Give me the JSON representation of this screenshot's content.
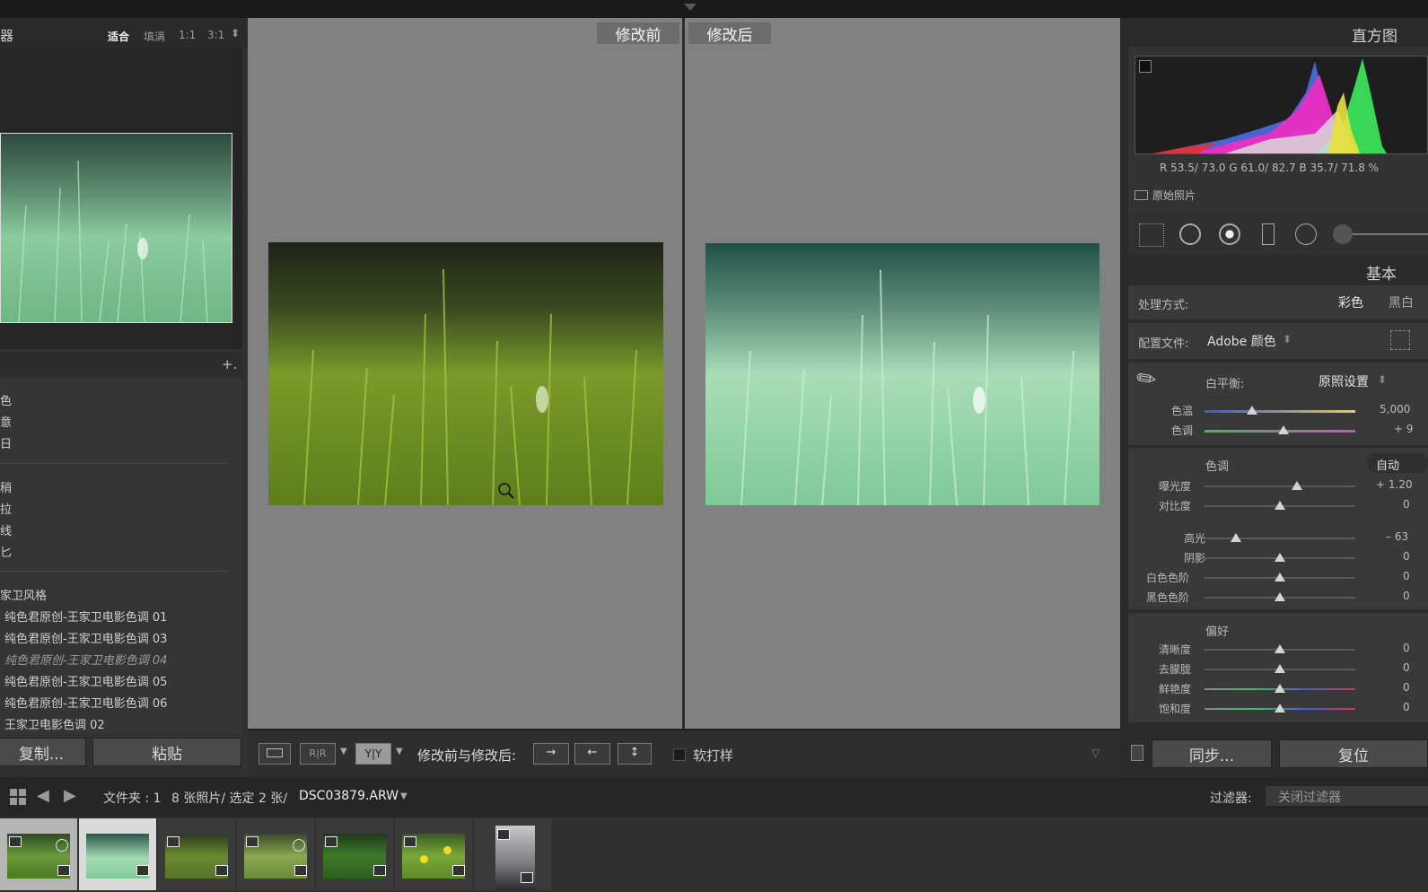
{
  "left_panel": {
    "nav_title": "器",
    "zoom_options": [
      "适合",
      "填满",
      "1:1",
      "3:1"
    ],
    "add_preset": "+.",
    "preset_groups": [
      [
        "色",
        "意",
        "日"
      ],
      [
        "稍",
        "拉",
        "线",
        "匕"
      ]
    ],
    "preset_folder": "家卫风格",
    "presets": [
      "纯色君原创-王家卫电影色调 01",
      "纯色君原创-王家卫电影色调 03",
      "纯色君原创-王家卫电影色调 04",
      "纯色君原创-王家卫电影色调 05",
      "纯色君原创-王家卫电影色调 06",
      "王家卫电影色调 02"
    ],
    "copy_button": "复制...",
    "paste_button": "粘贴"
  },
  "center": {
    "before_label": "修改前",
    "after_label": "修改后",
    "toolbar": {
      "view_label": "修改前与修改后:",
      "soft_proof": "软打样",
      "ra_text": "R|R",
      "yy_text": "Y|Y"
    }
  },
  "right_panel": {
    "histogram_title": "直方图",
    "readout": "R 53.5/ 73.0  G 61.0/ 82.7  B 35.7/ 71.8 %",
    "original_photo": "原始照片",
    "basic_title": "基本",
    "treatment_label": "处理方式:",
    "treatment_color": "彩色",
    "treatment_bw": "黑白",
    "profile_label": "配置文件:",
    "profile_value": "Adobe 颜色",
    "wb_label": "白平衡:",
    "wb_value": "原照设置",
    "temp_label": "色温",
    "temp_value": "5,000",
    "tint_label": "色调",
    "tint_value": "+ 9",
    "tone_label": "色调",
    "auto_label": "自动",
    "exposure_label": "曝光度",
    "exposure_value": "+ 1.20",
    "contrast_label": "对比度",
    "contrast_value": "0",
    "highlights_label": "高光",
    "highlights_value": "– 63",
    "shadows_label": "阴影",
    "shadows_value": "0",
    "whites_label": "白色色阶",
    "whites_value": "0",
    "blacks_label": "黑色色阶",
    "blacks_value": "0",
    "presence_label": "偏好",
    "clarity_label": "清晰度",
    "clarity_value": "0",
    "dehaze_label": "去朦胧",
    "dehaze_value": "0",
    "vibrance_label": "鲜艳度",
    "vibrance_value": "0",
    "saturation_label": "饱和度",
    "saturation_value": "0",
    "sync_button": "同步...",
    "reset_button": "复位"
  },
  "filmstrip": {
    "folder_info": "文件夹 : 1",
    "count_info": "8 张照片/ 选定 2 张/",
    "filename": "DSC03879.ARW",
    "filter_label": "过滤器:",
    "filter_value": "关闭过滤器"
  }
}
